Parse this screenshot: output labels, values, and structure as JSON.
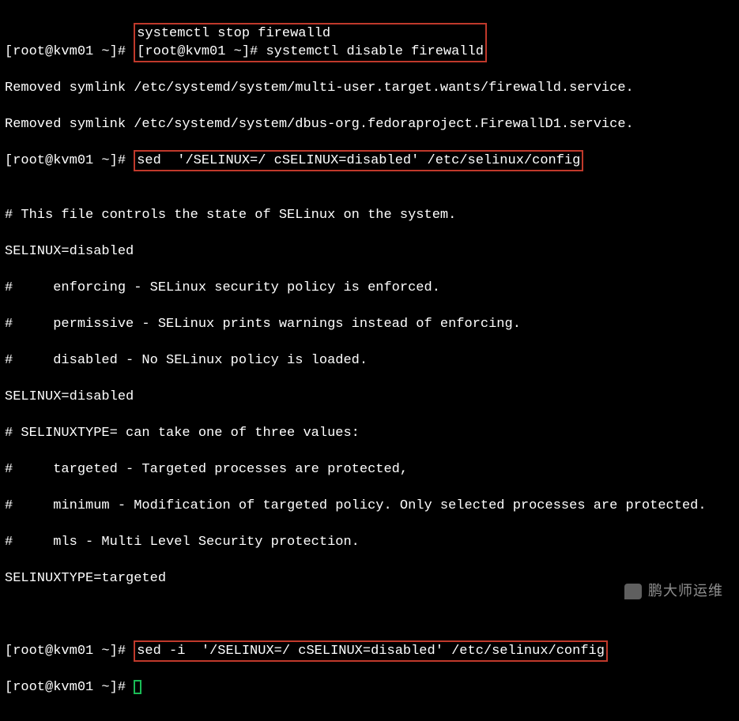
{
  "prompt_parts": {
    "open": "[root@kvm01 ~]# "
  },
  "commands": {
    "stop_fw": "systemctl stop firewalld",
    "disable_fw": "systemctl disable firewalld",
    "sed_preview": "sed  '/SELINUX=/ cSELINUX=disabled' /etc/selinux/config",
    "sed_inplace": "sed -i  '/SELINUX=/ cSELINUX=disabled' /etc/selinux/config"
  },
  "output": {
    "rm1": "Removed symlink /etc/systemd/system/multi-user.target.wants/firewalld.service.",
    "rm2": "Removed symlink /etc/systemd/system/dbus-org.fedoraproject.FirewallD1.service.",
    "blank": "",
    "cfg01": "# This file controls the state of SELinux on the system.",
    "cfg02": "SELINUX=disabled",
    "cfg03": "#     enforcing - SELinux security policy is enforced.",
    "cfg04": "#     permissive - SELinux prints warnings instead of enforcing.",
    "cfg05": "#     disabled - No SELinux policy is loaded.",
    "cfg06": "SELINUX=disabled",
    "cfg07": "# SELINUXTYPE= can take one of three values:",
    "cfg08": "#     targeted - Targeted processes are protected,",
    "cfg09": "#     minimum - Modification of targeted policy. Only selected processes are protected.",
    "cfg10": "#     mls - Multi Level Security protection.",
    "cfg11": "SELINUXTYPE=targeted"
  },
  "watermark": {
    "text": "鹏大师运维"
  }
}
